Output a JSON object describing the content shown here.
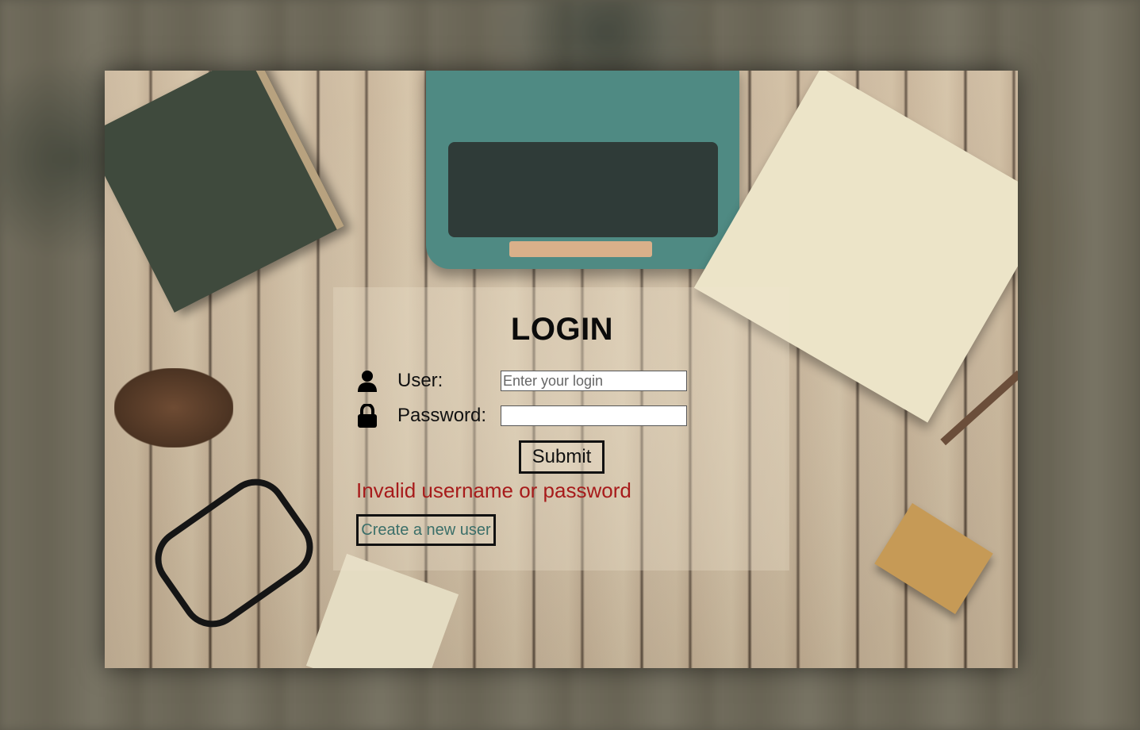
{
  "login": {
    "title": "LOGIN",
    "user_label": "User:",
    "user_placeholder": "Enter your login",
    "user_value": "",
    "password_label": "Password:",
    "password_value": "",
    "submit_label": "Submit",
    "error_message": "Invalid username or password",
    "create_user_label": "Create a new user"
  },
  "icons": {
    "user": "user-icon",
    "password": "lock-icon"
  },
  "colors": {
    "error": "#a71b1b",
    "link": "#3b6f69"
  }
}
